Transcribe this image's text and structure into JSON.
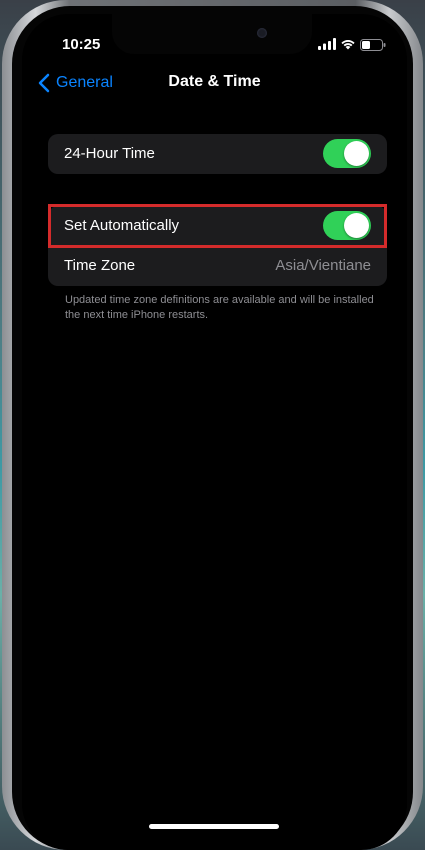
{
  "status_bar": {
    "time": "10:25",
    "icons": [
      "signal-icon",
      "wifi-icon",
      "battery-icon"
    ]
  },
  "nav": {
    "back_label": "General",
    "title": "Date & Time"
  },
  "settings": {
    "hour24": {
      "label": "24-Hour Time",
      "enabled": true
    },
    "set_automatically": {
      "label": "Set Automatically",
      "enabled": true,
      "highlighted": true
    },
    "time_zone": {
      "label": "Time Zone",
      "value": "Asia/Vientiane"
    }
  },
  "footer_note": "Updated time zone definitions are available and will be installed the next time iPhone restarts.",
  "colors": {
    "accent": "#0a84ff",
    "toggle_on": "#30d158",
    "highlight": "#d42b2b",
    "cell_bg": "#1c1c1e",
    "secondary_text": "#8e8e93"
  }
}
